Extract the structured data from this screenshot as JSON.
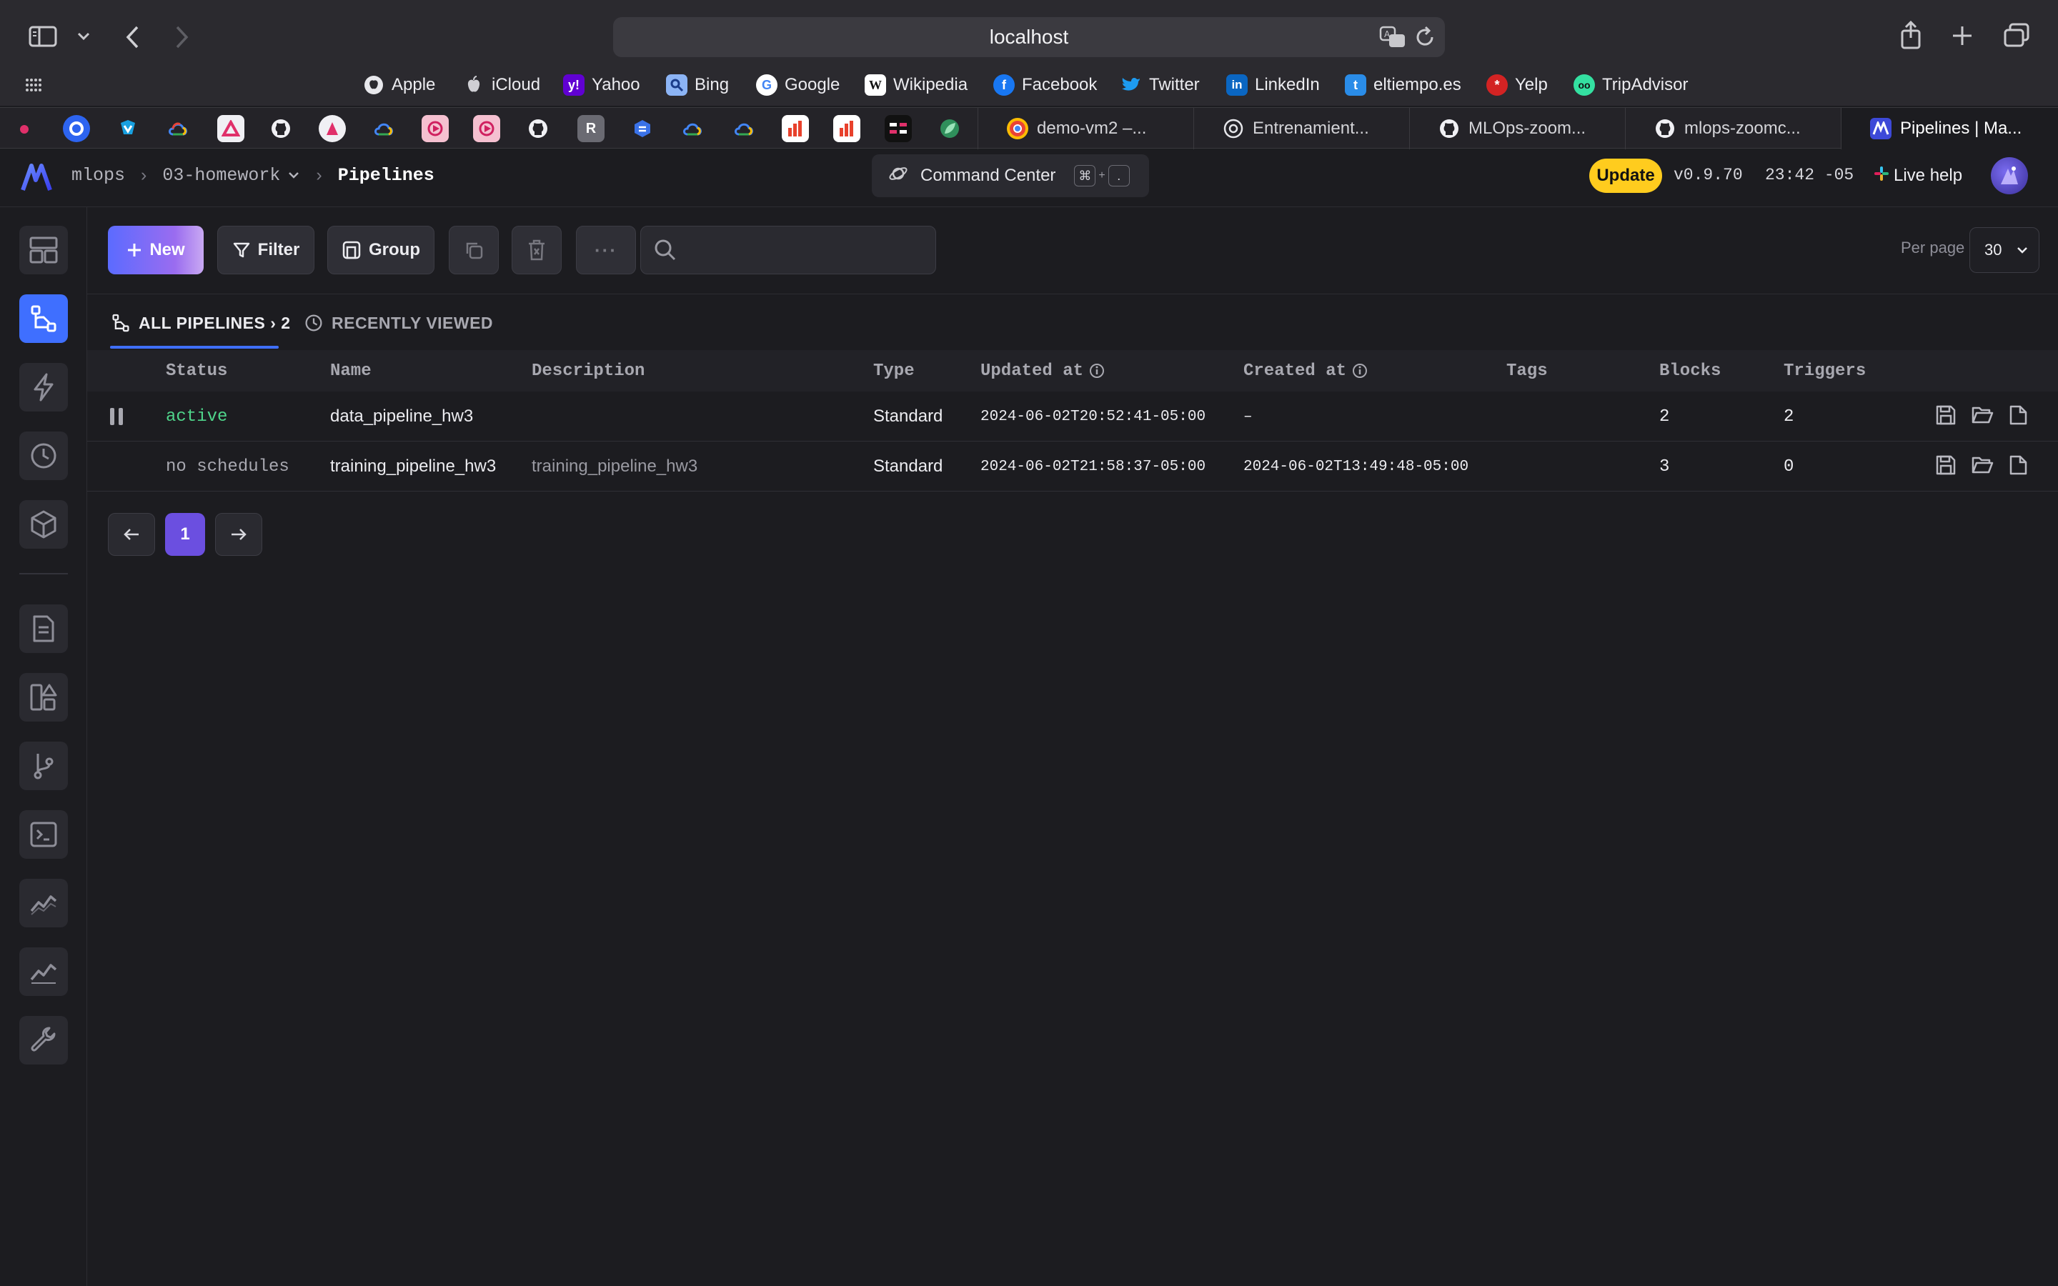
{
  "browser": {
    "url": "localhost",
    "bookmarks": [
      {
        "label": "Apple",
        "color": "#2b2a2f",
        "glyph": ""
      },
      {
        "label": "iCloud",
        "color": "#2b2a2f",
        "glyph": ""
      },
      {
        "label": "Yahoo",
        "color": "#6001d2",
        "glyph": "y!"
      },
      {
        "label": "Bing",
        "color": "#3a6ee8",
        "glyph": "b"
      },
      {
        "label": "Google",
        "color": "#ffffff",
        "glyph": "G"
      },
      {
        "label": "Wikipedia",
        "color": "#ffffff",
        "glyph": "W"
      },
      {
        "label": "Facebook",
        "color": "#1877f2",
        "glyph": "f"
      },
      {
        "label": "Twitter",
        "color": "#1d9bf0",
        "glyph": ""
      },
      {
        "label": "LinkedIn",
        "color": "#0a66c2",
        "glyph": "in"
      },
      {
        "label": "eltiempo.es",
        "color": "#2a8ce8",
        "glyph": "t"
      },
      {
        "label": "Yelp",
        "color": "#d32323",
        "glyph": "*"
      },
      {
        "label": "TripAdvisor",
        "color": "#34e0a1",
        "glyph": "oo"
      }
    ],
    "tabs": [
      {
        "label": "demo-vm2 –..."
      },
      {
        "label": "Entrenamient..."
      },
      {
        "label": "MLOps-zoom..."
      },
      {
        "label": "mlops-zoomc..."
      },
      {
        "label": "Pipelines | Ma..."
      }
    ]
  },
  "header": {
    "breadcrumb_project": "mlops",
    "breadcrumb_folder": "03-homework",
    "breadcrumb_page": "Pipelines",
    "command_center": "Command Center",
    "shortcut_key_1": "⌘",
    "shortcut_plus": "+",
    "shortcut_key_2": ".",
    "update_label": "Update",
    "version": "v0.9.70",
    "clock": "23:42 -05",
    "live_help": "Live help"
  },
  "toolbar": {
    "new_label": "New",
    "filter_label": "Filter",
    "group_label": "Group",
    "more_label": "···",
    "search_placeholder": "",
    "per_page_label": "Per page",
    "per_page_value": "30"
  },
  "view_tabs": {
    "all_label": "ALL PIPELINES › 2",
    "recent_label": "RECENTLY VIEWED"
  },
  "table": {
    "columns": [
      "Status",
      "Name",
      "Description",
      "Type",
      "Updated at",
      "Created at",
      "Tags",
      "Blocks",
      "Triggers"
    ],
    "rows": [
      {
        "status": "active",
        "name": "data_pipeline_hw3",
        "description": "",
        "type": "Standard",
        "updated_at": "2024-06-02T20:52:41-05:00",
        "created_at": "–",
        "tags": "",
        "blocks": "2",
        "triggers": "2"
      },
      {
        "status": "no schedules",
        "name": "training_pipeline_hw3",
        "description": "training_pipeline_hw3",
        "type": "Standard",
        "updated_at": "2024-06-02T21:58:37-05:00",
        "created_at": "2024-06-02T13:49:48-05:00",
        "tags": "",
        "blocks": "3",
        "triggers": "0"
      }
    ]
  },
  "pagination": {
    "current_page": "1"
  },
  "colors": {
    "accent_blue": "#3f6fff",
    "status_active": "#4fd48a",
    "update_yellow": "#ffcc1e",
    "page_active": "#6b4fe0"
  }
}
